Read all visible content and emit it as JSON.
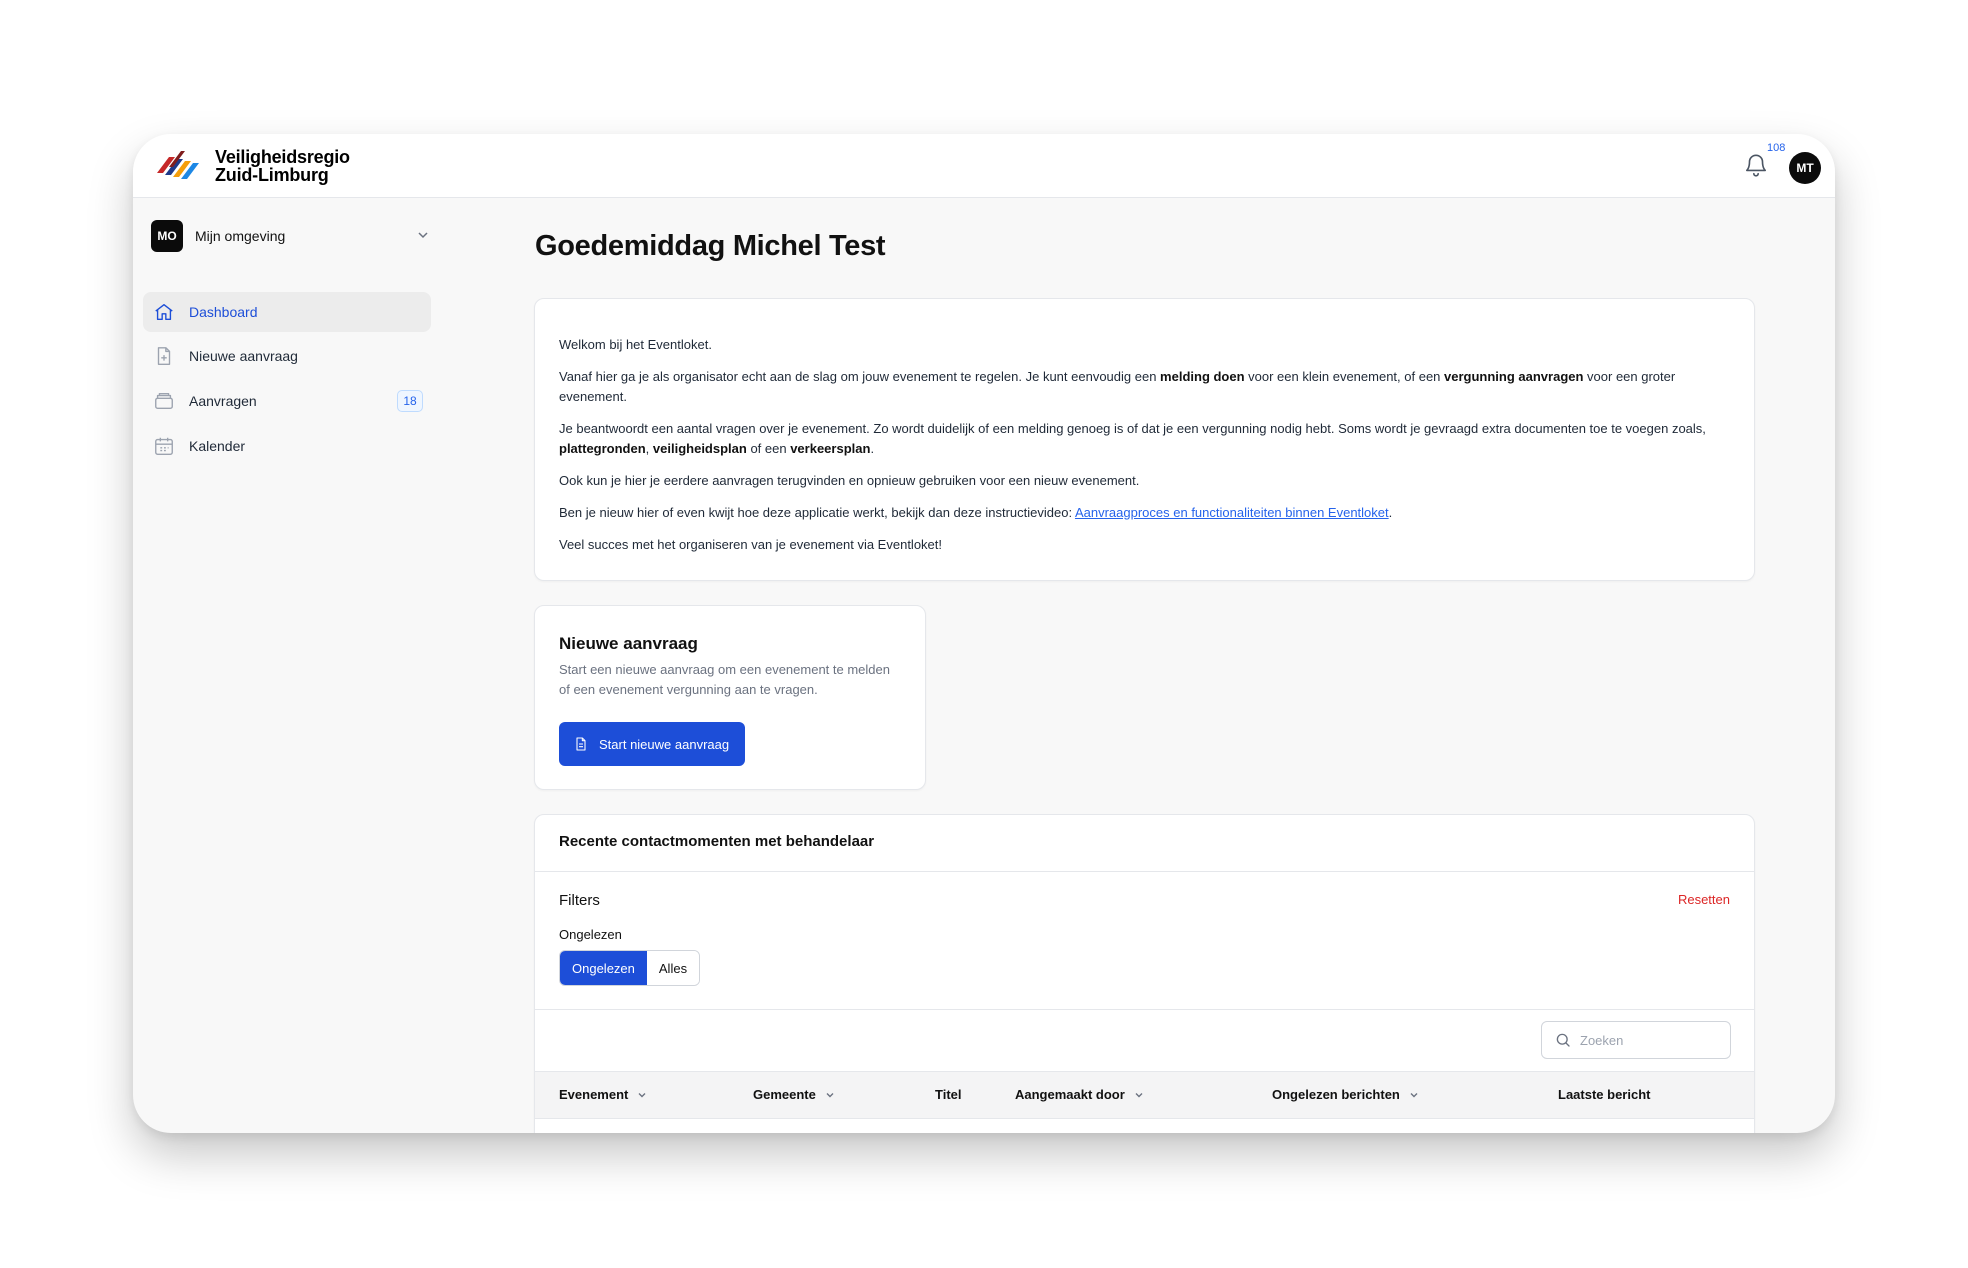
{
  "brand": {
    "line1": "Veiligheidsregio",
    "line2": "Zuid-Limburg"
  },
  "header": {
    "notification_count": "108",
    "user_initials": "MT"
  },
  "environment": {
    "badge": "MO",
    "label": "Mijn omgeving"
  },
  "sidebar": {
    "items": [
      {
        "label": "Dashboard",
        "icon": "home-icon",
        "active": true
      },
      {
        "label": "Nieuwe aanvraag",
        "icon": "file-plus-icon"
      },
      {
        "label": "Aanvragen",
        "icon": "inbox-icon",
        "count": "18"
      },
      {
        "label": "Kalender",
        "icon": "calendar-icon"
      }
    ]
  },
  "main": {
    "greeting": "Goedemiddag Michel Test",
    "welcome": {
      "p1": "Welkom bij het Eventloket.",
      "p2_a": "Vanaf hier ga je als organisator echt aan de slag om jouw evenement te regelen. Je kunt eenvoudig een ",
      "p2_b1": "melding doen",
      "p2_c": " voor een klein evenement, of een ",
      "p2_b2": "vergunning aanvragen",
      "p2_d": " voor een groter evenement.",
      "p3_a": "Je beantwoordt een aantal vragen over je evenement. Zo wordt duidelijk of een melding genoeg is of dat je een vergunning nodig hebt. Soms wordt je gevraagd extra documenten toe te voegen zoals, ",
      "p3_b1": "plattegronden",
      "p3_c": ", ",
      "p3_b2": "veiligheidsplan",
      "p3_d": " of een ",
      "p3_b3": "verkeersplan",
      "p3_e": ".",
      "p4": "Ook kun je hier je eerdere aanvragen terugvinden en opnieuw gebruiken voor een nieuw evenement.",
      "p5_a": "Ben je nieuw hier of even kwijt hoe deze applicatie werkt, bekijk dan deze instructievideo: ",
      "p5_link": "Aanvraagproces en functionaliteiten binnen Eventloket",
      "p5_b": ".",
      "p6": "Veel succes met het organiseren van je evenement via Eventloket!"
    },
    "new_request": {
      "title": "Nieuwe aanvraag",
      "description": "Start een nieuwe aanvraag om een evenement te melden of een evenement vergunning aan te vragen.",
      "button": "Start nieuwe aanvraag"
    },
    "contacts": {
      "title": "Recente contactmomenten met behandelaar",
      "filters_title": "Filters",
      "reset": "Resetten",
      "filter_label": "Ongelezen",
      "toggle": [
        "Ongelezen",
        "Alles"
      ],
      "search_placeholder": "Zoeken",
      "columns": [
        "Evenement",
        "Gemeente",
        "Titel",
        "Aangemaakt door",
        "Ongelezen berichten",
        "Laatste bericht"
      ]
    }
  },
  "colors": {
    "accent": "#1d4ed8",
    "danger": "#dc2626"
  }
}
